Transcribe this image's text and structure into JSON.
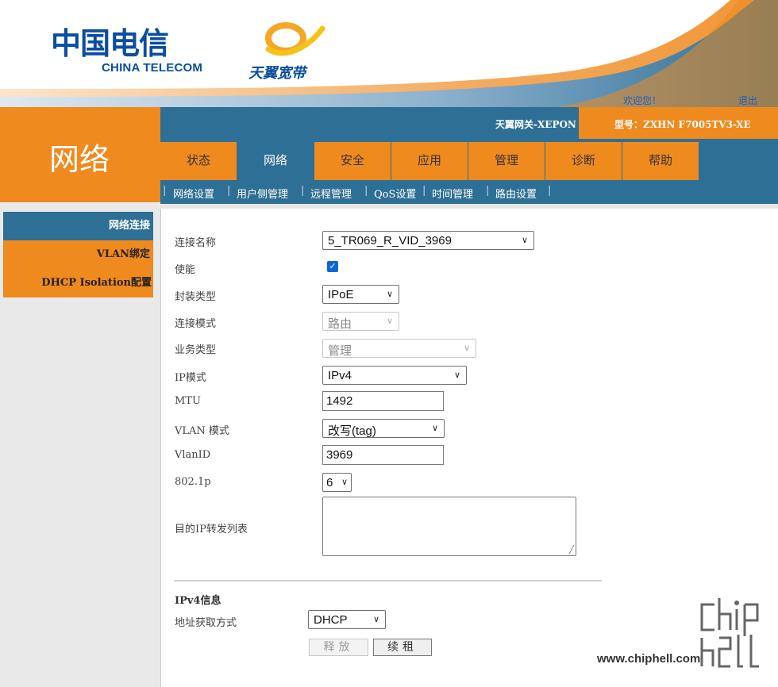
{
  "header": {
    "logo_cn": "中国电信",
    "logo_en": "CHINA TELECOM",
    "tianyi_logo": "天翼宽带",
    "welcome": "欢迎您！",
    "logout": "退出",
    "gateway_name": "天翼网关-XEPON",
    "model": "型号：ZXHN F7005TV3-XE"
  },
  "section_title": "网络",
  "main_nav": [
    {
      "label": "状态"
    },
    {
      "label": "网络",
      "active": true
    },
    {
      "label": "安全"
    },
    {
      "label": "应用"
    },
    {
      "label": "管理"
    },
    {
      "label": "诊断"
    },
    {
      "label": "帮助"
    }
  ],
  "sub_nav": [
    "网络设置",
    "用户侧管理",
    "远程管理",
    "QoS设置",
    "时间管理",
    "路由设置"
  ],
  "sidebar": [
    {
      "label": "网络连接",
      "active": true
    },
    {
      "label": "VLAN绑定"
    },
    {
      "label": "DHCP Isolation配置"
    }
  ],
  "form": {
    "connection_name": {
      "label": "连接名称",
      "value": "5_TR069_R_VID_3969"
    },
    "enable": {
      "label": "使能",
      "checked": true
    },
    "encapsulation": {
      "label": "封装类型",
      "value": "IPoE"
    },
    "connection_mode": {
      "label": "连接模式",
      "value": "路由",
      "disabled": true
    },
    "service_type": {
      "label": "业务类型",
      "value": "管理",
      "disabled": true
    },
    "ip_mode": {
      "label": "IP模式",
      "value": "IPv4"
    },
    "mtu": {
      "label": "MTU",
      "value": "1492"
    },
    "vlan_mode": {
      "label": "VLAN 模式",
      "value": "改写(tag)"
    },
    "vlan_id": {
      "label": "VlanID",
      "value": "3969"
    },
    "dot1p": {
      "label": "802.1p",
      "value": "6"
    },
    "dest_ip_list": {
      "label": "目的IP转发列表",
      "value": ""
    }
  },
  "ipv4": {
    "section_label": "IPv4信息",
    "addr_mode_label": "地址获取方式",
    "addr_mode_value": "DHCP",
    "release_button": "释放",
    "renew_button": "续租"
  },
  "watermark": {
    "url": "www.chiphell.com",
    "logo_text": "chip hell"
  },
  "colors": {
    "orange": "#ef8a1f",
    "blue": "#2e6f95",
    "checkbox": "#0a66d8"
  },
  "icons": {
    "chevron": "chevron-down-icon",
    "check": "checkmark-icon"
  }
}
